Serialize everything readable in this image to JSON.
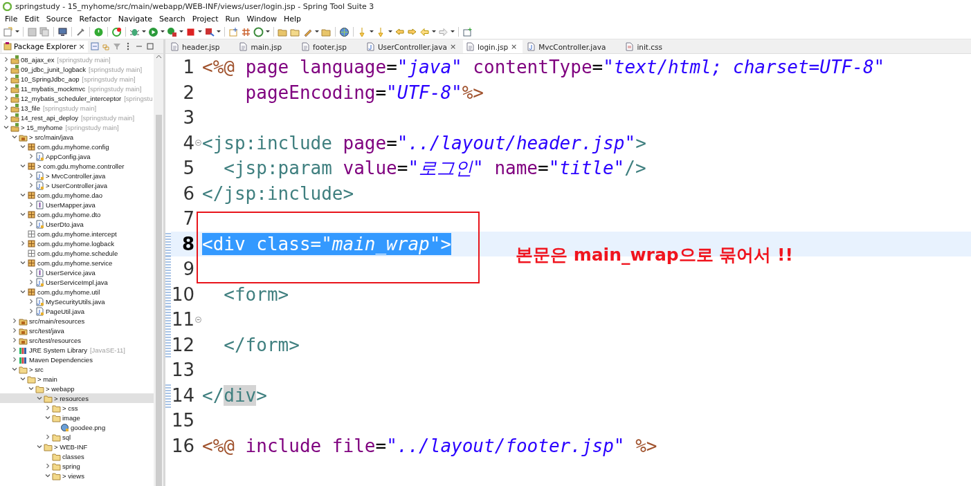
{
  "window": {
    "title": "springstudy - 15_myhome/src/main/webapp/WEB-INF/views/user/login.jsp - Spring Tool Suite 3"
  },
  "menu": [
    "File",
    "Edit",
    "Source",
    "Refactor",
    "Navigate",
    "Search",
    "Project",
    "Run",
    "Window",
    "Help"
  ],
  "package_explorer": {
    "title": "Package Explorer",
    "close": "×",
    "tree": [
      {
        "label": "08_ajax_ex",
        "decoration": "[springstudy main]",
        "kind": "project",
        "expanded": false,
        "selected": false
      },
      {
        "label": "09_jdbc_junit_logback",
        "decoration": "[springstudy main]",
        "kind": "project",
        "expanded": false,
        "selected": false
      },
      {
        "label": "10_SpringJdbc_aop",
        "decoration": "[springstudy main]",
        "kind": "project",
        "expanded": false,
        "selected": false
      },
      {
        "label": "11_mybatis_mockmvc",
        "decoration": "[springstudy main]",
        "kind": "project",
        "expanded": false,
        "selected": false
      },
      {
        "label": "12_mybatis_scheduler_interceptor",
        "decoration": "[springstu",
        "kind": "project",
        "expanded": false,
        "selected": false
      },
      {
        "label": "13_file",
        "decoration": "[springstudy main]",
        "kind": "project",
        "expanded": false,
        "selected": false
      },
      {
        "label": "14_rest_api_deploy",
        "decoration": "[springstudy main]",
        "kind": "project",
        "expanded": false,
        "selected": false
      },
      {
        "label": "> 15_myhome",
        "decoration": "[springstudy main]",
        "kind": "project",
        "expanded": true,
        "selected": false,
        "children": [
          {
            "label": "> src/main/java",
            "kind": "source-folder",
            "expanded": true,
            "selected": false,
            "children": [
              {
                "label": "com.gdu.myhome.config",
                "kind": "package",
                "expanded": true,
                "selected": false,
                "children": [
                  {
                    "label": "AppConfig.java",
                    "kind": "java",
                    "expanded": false,
                    "selected": false
                  }
                ]
              },
              {
                "label": "> com.gdu.myhome.controller",
                "kind": "package",
                "expanded": true,
                "selected": false,
                "children": [
                  {
                    "label": "> MvcController.java",
                    "kind": "java",
                    "expanded": false,
                    "selected": false
                  },
                  {
                    "label": "> UserController.java",
                    "kind": "java",
                    "expanded": false,
                    "selected": false
                  }
                ]
              },
              {
                "label": "com.gdu.myhome.dao",
                "kind": "package",
                "expanded": true,
                "selected": false,
                "children": [
                  {
                    "label": "UserMapper.java",
                    "kind": "interface",
                    "expanded": false,
                    "selected": false
                  }
                ]
              },
              {
                "label": "com.gdu.myhome.dto",
                "kind": "package",
                "expanded": true,
                "selected": false,
                "children": [
                  {
                    "label": "UserDto.java",
                    "kind": "java",
                    "expanded": false,
                    "selected": false
                  }
                ]
              },
              {
                "label": "com.gdu.myhome.intercept",
                "kind": "package-empty",
                "selected": false
              },
              {
                "label": "com.gdu.myhome.logback",
                "kind": "package",
                "expanded": false,
                "selected": false
              },
              {
                "label": "com.gdu.myhome.schedule",
                "kind": "package-empty",
                "selected": false
              },
              {
                "label": "com.gdu.myhome.service",
                "kind": "package",
                "expanded": true,
                "selected": false,
                "children": [
                  {
                    "label": "UserService.java",
                    "kind": "interface",
                    "expanded": false,
                    "selected": false
                  },
                  {
                    "label": "UserServiceImpl.java",
                    "kind": "java",
                    "expanded": false,
                    "selected": false
                  }
                ]
              },
              {
                "label": "com.gdu.myhome.util",
                "kind": "package",
                "expanded": true,
                "selected": false,
                "children": [
                  {
                    "label": "MySecurityUtils.java",
                    "kind": "java",
                    "expanded": false,
                    "selected": false
                  },
                  {
                    "label": "PageUtil.java",
                    "kind": "java",
                    "expanded": false,
                    "selected": false
                  }
                ]
              }
            ]
          },
          {
            "label": "src/main/resources",
            "kind": "source-folder",
            "expanded": false,
            "selected": false
          },
          {
            "label": "src/test/java",
            "kind": "source-folder",
            "expanded": false,
            "selected": false
          },
          {
            "label": "src/test/resources",
            "kind": "source-folder",
            "expanded": false,
            "selected": false
          },
          {
            "label": "JRE System Library",
            "decoration": "[JavaSE-11]",
            "kind": "library",
            "expanded": false,
            "selected": false
          },
          {
            "label": "Maven Dependencies",
            "kind": "library",
            "expanded": false,
            "selected": false
          },
          {
            "label": "> src",
            "kind": "folder",
            "expanded": true,
            "selected": false,
            "children": [
              {
                "label": "> main",
                "kind": "folder",
                "expanded": true,
                "selected": false,
                "children": [
                  {
                    "label": "> webapp",
                    "kind": "folder",
                    "expanded": true,
                    "selected": false,
                    "children": [
                      {
                        "label": "> resources",
                        "kind": "folder",
                        "expanded": true,
                        "selected": true,
                        "children": [
                          {
                            "label": "> css",
                            "kind": "folder",
                            "expanded": false,
                            "selected": false
                          },
                          {
                            "label": "image",
                            "kind": "folder",
                            "expanded": true,
                            "selected": false,
                            "children": [
                              {
                                "label": "goodee.png",
                                "kind": "image",
                                "selected": false
                              }
                            ]
                          },
                          {
                            "label": "sql",
                            "kind": "folder",
                            "expanded": false,
                            "selected": false
                          }
                        ]
                      },
                      {
                        "label": "> WEB-INF",
                        "kind": "folder",
                        "expanded": true,
                        "selected": false,
                        "children": [
                          {
                            "label": "classes",
                            "kind": "folder",
                            "selected": false
                          },
                          {
                            "label": "spring",
                            "kind": "folder",
                            "expanded": false,
                            "selected": false
                          },
                          {
                            "label": "> views",
                            "kind": "folder",
                            "expanded": true,
                            "selected": false
                          }
                        ]
                      }
                    ]
                  }
                ]
              }
            ]
          }
        ]
      }
    ]
  },
  "editor_tabs": [
    {
      "label": "header.jsp",
      "kind": "jsp",
      "selected": false
    },
    {
      "label": "main.jsp",
      "kind": "jsp",
      "selected": false
    },
    {
      "label": "footer.jsp",
      "kind": "jsp",
      "selected": false
    },
    {
      "label": "UserController.java",
      "kind": "java",
      "selected": false,
      "close": "×"
    },
    {
      "label": "login.jsp",
      "kind": "jsp",
      "selected": true,
      "close": "×"
    },
    {
      "label": "MvcController.java",
      "kind": "java",
      "selected": false
    },
    {
      "label": "init.css",
      "kind": "css",
      "selected": false
    }
  ],
  "editor": {
    "lines": [
      {
        "n": "1",
        "changed": false,
        "current": false,
        "selected": false,
        "tokens": [
          {
            "kind": "delim",
            "text": "<%@ "
          },
          {
            "kind": "attr",
            "text": "page language"
          },
          {
            "kind": "plain",
            "text": "="
          },
          {
            "kind": "string",
            "text": "\"java\""
          },
          {
            "kind": "attr",
            "text": " contentType"
          },
          {
            "kind": "plain",
            "text": "="
          },
          {
            "kind": "string",
            "text": "\"text/html; charset=UTF-8\""
          }
        ]
      },
      {
        "n": "2",
        "changed": false,
        "current": false,
        "selected": false,
        "tokens": [
          {
            "kind": "attr",
            "text": "    pageEncoding"
          },
          {
            "kind": "plain",
            "text": "="
          },
          {
            "kind": "string",
            "text": "\"UTF-8\""
          },
          {
            "kind": "delim",
            "text": "%>"
          }
        ]
      },
      {
        "n": "3",
        "changed": false,
        "current": false,
        "selected": false
      },
      {
        "n": "4",
        "changed": false,
        "current": false,
        "selected": false,
        "fold": true,
        "tokens": [
          {
            "kind": "tag",
            "text": "<jsp:include"
          },
          {
            "kind": "attr",
            "text": " page"
          },
          {
            "kind": "plain",
            "text": "="
          },
          {
            "kind": "string",
            "text": "\"../layout/header.jsp\""
          },
          {
            "kind": "tag",
            "text": ">"
          }
        ]
      },
      {
        "n": "5",
        "changed": false,
        "current": false,
        "selected": false,
        "tokens": [
          {
            "kind": "tag",
            "text": "  <jsp:param"
          },
          {
            "kind": "attr",
            "text": " value"
          },
          {
            "kind": "plain",
            "text": "="
          },
          {
            "kind": "string",
            "text": "\"로그인\""
          },
          {
            "kind": "attr",
            "text": " name"
          },
          {
            "kind": "plain",
            "text": "="
          },
          {
            "kind": "string",
            "text": "\"title\""
          },
          {
            "kind": "tag",
            "text": "/>"
          }
        ]
      },
      {
        "n": "6",
        "changed": false,
        "current": false,
        "selected": false,
        "tokens": [
          {
            "kind": "tag",
            "text": "</jsp:include>"
          }
        ]
      },
      {
        "n": "7",
        "changed": false,
        "current": false,
        "selected": false
      },
      {
        "n": "8",
        "changed": true,
        "current": true,
        "selected": true,
        "tokens": [
          {
            "kind": "tag",
            "text": "<div"
          },
          {
            "kind": "attr",
            "text": " class"
          },
          {
            "kind": "plain",
            "text": "="
          },
          {
            "kind": "string",
            "text": "\"main_wrap\""
          },
          {
            "kind": "tag",
            "text": ">"
          }
        ]
      },
      {
        "n": "9",
        "changed": true,
        "current": false,
        "selected": false
      },
      {
        "n": "10",
        "changed": true,
        "current": false,
        "selected": false,
        "tokens": [
          {
            "kind": "tag",
            "text": "  <form>"
          }
        ]
      },
      {
        "n": "11",
        "changed": true,
        "current": false,
        "selected": false,
        "fold": true
      },
      {
        "n": "12",
        "changed": true,
        "current": false,
        "selected": false,
        "tokens": [
          {
            "kind": "tag",
            "text": "  </form>"
          }
        ]
      },
      {
        "n": "13",
        "changed": false,
        "current": false,
        "selected": false
      },
      {
        "n": "14",
        "changed": true,
        "current": false,
        "selected": false,
        "tokens": [
          {
            "kind": "tag",
            "text": "</"
          },
          {
            "kind": "match",
            "text": "div"
          },
          {
            "kind": "tag",
            "text": ">"
          }
        ]
      },
      {
        "n": "15",
        "changed": false,
        "current": false,
        "selected": false
      },
      {
        "n": "16",
        "changed": false,
        "current": false,
        "selected": false,
        "tokens": [
          {
            "kind": "delim",
            "text": "<%@"
          },
          {
            "kind": "attr",
            "text": " include file"
          },
          {
            "kind": "plain",
            "text": "="
          },
          {
            "kind": "string",
            "text": "\"../layout/footer.jsp\""
          },
          {
            "kind": "delim",
            "text": " %>"
          }
        ]
      }
    ]
  },
  "annotation": {
    "text": "본문은 main_wrap으로 묶어서 !!"
  }
}
